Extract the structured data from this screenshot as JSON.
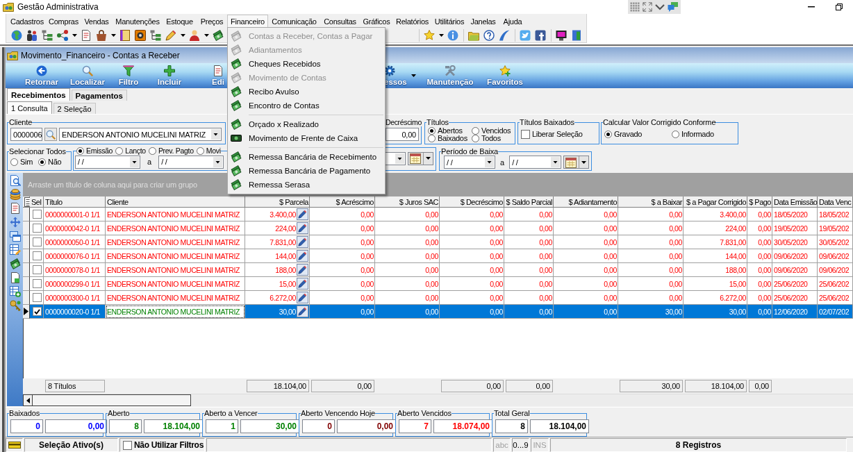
{
  "window": {
    "title": "Gestão Administrativa"
  },
  "menu": [
    {
      "label": "Cadastros",
      "selected": false
    },
    {
      "label": "Compras",
      "selected": false
    },
    {
      "label": "Vendas",
      "selected": false
    },
    {
      "label": "Manutenções",
      "selected": false
    },
    {
      "label": "Estoque",
      "selected": false
    },
    {
      "label": "Preços",
      "selected": false
    },
    {
      "label": "Financeiro",
      "selected": true,
      "items": [
        {
          "kind": "item",
          "label": "Contas a Receber, Contas a Pagar",
          "disabled": true
        },
        {
          "kind": "item",
          "label": "Adiantamentos",
          "disabled": true
        },
        {
          "kind": "item",
          "label": "Cheques Recebidos",
          "disabled": false
        },
        {
          "kind": "item",
          "label": "Movimento de Contas",
          "disabled": true
        },
        {
          "kind": "item",
          "label": "Recibo Avulso",
          "disabled": false
        },
        {
          "kind": "item",
          "label": "Encontro de Contas",
          "disabled": false
        },
        {
          "kind": "separator"
        },
        {
          "kind": "item",
          "label": "Orçado x Realizado",
          "disabled": false
        },
        {
          "kind": "item",
          "label": "Movimento de Frente de Caixa",
          "disabled": false
        },
        {
          "kind": "separator"
        },
        {
          "kind": "item",
          "label": "Remessa Bancária de Recebimento",
          "disabled": false
        },
        {
          "kind": "item",
          "label": "Remessa Bancária de Pagamento",
          "disabled": false
        },
        {
          "kind": "item",
          "label": "Remessa Serasa",
          "disabled": false
        }
      ]
    },
    {
      "label": "Comunicação",
      "selected": false
    },
    {
      "label": "Consultas",
      "selected": false
    },
    {
      "label": "Gráficos",
      "selected": false
    },
    {
      "label": "Relatórios",
      "selected": false
    },
    {
      "label": "Utilitários",
      "selected": false
    },
    {
      "label": "Janelas",
      "selected": false
    },
    {
      "label": "Ajuda",
      "selected": false
    }
  ],
  "child_window": {
    "title": "Movimento_Financeiro - Contas a Receber"
  },
  "ribbon": [
    {
      "label": "Retornar",
      "dropdown": false
    },
    {
      "label": "Localizar",
      "dropdown": false
    },
    {
      "label": "Filtro",
      "dropdown": false
    },
    {
      "label": "Incluir",
      "dropdown": false
    },
    {
      "label": "Edi",
      "dropdown": false
    },
    {
      "label": "essos",
      "dropdown": true
    },
    {
      "label": "Manutenção",
      "dropdown": false
    },
    {
      "label": "Favoritos",
      "dropdown": false
    }
  ],
  "tabs": [
    {
      "label": "Recebimentos",
      "selected": true
    },
    {
      "label": "Pagamentos",
      "selected": false
    }
  ],
  "subtabs": [
    {
      "label": "1 Consulta",
      "selected": true
    },
    {
      "label": "2 Seleção",
      "selected": false
    }
  ],
  "form": {
    "cliente": {
      "label": "Cliente",
      "code": "0000006",
      "name": "ENDERSON ANTONIO MUCELINI MATRIZ"
    },
    "decrescimo": {
      "label": "Decréscimo",
      "value": "0,00"
    },
    "titulos": {
      "label": "Títulos",
      "options": [
        {
          "label": "Abertos",
          "selected": true
        },
        {
          "label": "Vencidos",
          "selected": false
        },
        {
          "label": "Baixados",
          "selected": false
        },
        {
          "label": "Todos",
          "selected": false
        }
      ]
    },
    "titulos_baixados": {
      "label": "Títulos Baixados",
      "checkbox": {
        "label": "Liberar Seleção",
        "checked": false
      }
    },
    "calcular": {
      "label": "Calcular Valor Corrigido Conforme",
      "options": [
        {
          "label": "Gravado",
          "selected": true
        },
        {
          "label": "Informado",
          "selected": false
        }
      ]
    },
    "selecionar_todos": {
      "label": "Selecionar Todos",
      "options": [
        {
          "label": "Sim",
          "selected": false
        },
        {
          "label": "Não",
          "selected": true
        }
      ]
    },
    "periodo": {
      "options": [
        {
          "label": "Emissão",
          "selected": true
        },
        {
          "label": "Lançto",
          "selected": false
        },
        {
          "label": "Prev. Pagto",
          "selected": false
        },
        {
          "label": "Movi",
          "selected": false
        }
      ],
      "from": "/ /",
      "separator": "a",
      "to": "/ /"
    },
    "periodo_baixa": {
      "label": "Período de Baixa",
      "from": "/ /",
      "separator": "a",
      "to": "/ /"
    }
  },
  "grid": {
    "group_hint": "Arraste um título de coluna aqui para criar um grupo",
    "select_column": {
      "label": "Sel"
    },
    "columns": [
      {
        "label": "Título",
        "kind": "text",
        "focused": false
      },
      {
        "label": "Cliente",
        "kind": "text",
        "focused": true
      },
      {
        "label": "$ Parcela",
        "kind": "amount_edit",
        "focused": false
      },
      {
        "label": "$ Acréscimo",
        "kind": "amount",
        "focused": false
      },
      {
        "label": "$ Juros SAC",
        "kind": "amount",
        "focused": false
      },
      {
        "label": "$ Decréscimo",
        "kind": "amount",
        "focused": false
      },
      {
        "label": "$ Saldo Parcial",
        "kind": "amount",
        "focused": false
      },
      {
        "label": "$ Adiantamento",
        "kind": "amount",
        "focused": false
      },
      {
        "label": "$ a Baixar",
        "kind": "amount",
        "focused": false
      },
      {
        "label": "$ a Pagar Corrigido",
        "kind": "amount",
        "focused": false
      },
      {
        "label": "$ Pago",
        "kind": "amount",
        "focused": false
      },
      {
        "label": "Data Emissão",
        "kind": "date",
        "focused": false
      },
      {
        "label": "Data Venc",
        "kind": "date",
        "focused": false
      }
    ],
    "rows": [
      {
        "checked": false,
        "selected": false,
        "color": "#ff0000",
        "cells": [
          "0000000001-0 1/1",
          "ENDERSON ANTONIO MUCELINI MATRIZ",
          "3.400,00",
          "0,00",
          "0,00",
          "0,00",
          "0,00",
          "0,00",
          "0,00",
          "3.400,00",
          "0,00",
          "18/05/2020",
          "18/05/202"
        ]
      },
      {
        "checked": false,
        "selected": false,
        "color": "#ff0000",
        "cells": [
          "0000000042-0 1/1",
          "ENDERSON ANTONIO MUCELINI MATRIZ",
          "224,00",
          "0,00",
          "0,00",
          "0,00",
          "0,00",
          "0,00",
          "0,00",
          "224,00",
          "0,00",
          "19/05/2020",
          "19/05/202"
        ]
      },
      {
        "checked": false,
        "selected": false,
        "color": "#ff0000",
        "cells": [
          "0000000050-0 1/1",
          "ENDERSON ANTONIO MUCELINI MATRIZ",
          "7.831,00",
          "0,00",
          "0,00",
          "0,00",
          "0,00",
          "0,00",
          "0,00",
          "7.831,00",
          "0,00",
          "30/05/2020",
          "30/05/202"
        ]
      },
      {
        "checked": false,
        "selected": false,
        "color": "#ff0000",
        "cells": [
          "0000000076-0 1/1",
          "ENDERSON ANTONIO MUCELINI MATRIZ",
          "144,00",
          "0,00",
          "0,00",
          "0,00",
          "0,00",
          "0,00",
          "0,00",
          "144,00",
          "0,00",
          "09/06/2020",
          "09/06/202"
        ]
      },
      {
        "checked": false,
        "selected": false,
        "color": "#ff0000",
        "cells": [
          "0000000078-0 1/1",
          "ENDERSON ANTONIO MUCELINI MATRIZ",
          "188,00",
          "0,00",
          "0,00",
          "0,00",
          "0,00",
          "0,00",
          "0,00",
          "188,00",
          "0,00",
          "09/06/2020",
          "09/06/202"
        ]
      },
      {
        "checked": false,
        "selected": false,
        "color": "#ff0000",
        "cells": [
          "0000000299-0 1/1",
          "ENDERSON ANTONIO MUCELINI MATRIZ",
          "15,00",
          "0,00",
          "0,00",
          "0,00",
          "0,00",
          "0,00",
          "0,00",
          "15,00",
          "0,00",
          "25/06/2020",
          "25/06/202"
        ]
      },
      {
        "checked": false,
        "selected": false,
        "color": "#ff0000",
        "cells": [
          "0000000300-0 1/1",
          "ENDERSON ANTONIO MUCELINI MATRIZ",
          "6.272,00",
          "0,00",
          "0,00",
          "0,00",
          "0,00",
          "0,00",
          "0,00",
          "6.272,00",
          "0,00",
          "25/06/2020",
          "25/06/202"
        ]
      },
      {
        "checked": true,
        "selected": true,
        "color": "#008000",
        "cells": [
          "0000000020-0 1/1",
          "ENDERSON ANTONIO MUCELINI MATRIZ",
          "30,00",
          "0,00",
          "0,00",
          "0,00",
          "0,00",
          "0,00",
          "30,00",
          "30,00",
          "0,00",
          "12/06/2020",
          "02/07/202"
        ]
      }
    ],
    "totals": [
      "8 Títulos",
      "18.104,00",
      "0,00",
      "0,00",
      "0,00",
      "30,00",
      "18.104,00",
      "0,00"
    ]
  },
  "summary": [
    {
      "label": "Baixados",
      "count": "0",
      "amount": "0,00",
      "color": "#0000ff"
    },
    {
      "label": "Aberto",
      "count": "8",
      "amount": "18.104,00",
      "color": "#008000"
    },
    {
      "label": "Aberto a Vencer",
      "count": "1",
      "amount": "30,00",
      "color": "#008000"
    },
    {
      "label": "Aberto Vencendo Hoje",
      "count": "0",
      "amount": "0,00",
      "color": "#800000"
    },
    {
      "label": "Aberto Vencidos",
      "count": "7",
      "amount": "18.074,00",
      "color": "#ff0000"
    },
    {
      "label": "Total Geral",
      "count": "8",
      "amount": "18.104,00",
      "color": "#000000"
    }
  ],
  "status_bar": {
    "selection": "Seleção Ativo(s)",
    "no_filters": {
      "label": "Não Utilizar Filtros",
      "checked": false
    },
    "indicators": [
      {
        "text": "abc",
        "enabled": false
      },
      {
        "text": "0...9",
        "enabled": true
      },
      {
        "text": "INS",
        "enabled": false
      }
    ],
    "records": "8 Registros"
  }
}
